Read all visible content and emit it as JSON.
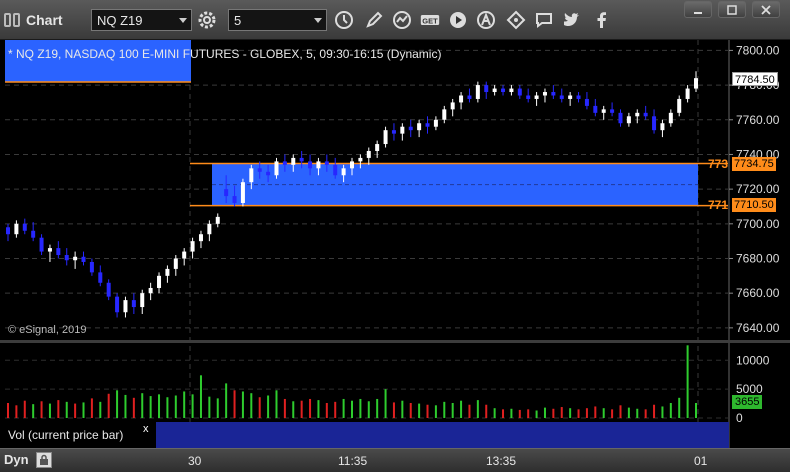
{
  "window": {
    "title": "Chart"
  },
  "toolbar": {
    "symbol_value": "NQ Z19",
    "interval_value": "5",
    "icons": [
      "link-icon",
      "gear-icon",
      "clock-icon",
      "pencil-icon",
      "study-icon",
      "get-icon",
      "play-icon",
      "alert-icon",
      "tools-icon",
      "comment-icon",
      "twitter-icon",
      "facebook-icon"
    ]
  },
  "chart": {
    "symbol_description": "* NQ Z19, NASDAQ 100 E-MINI FUTURES - GLOBEX, 5, 09:30-16:15 (Dynamic)",
    "copyright": "© eSignal, 2019",
    "last_price": "7784.50",
    "zone_high_price": "7734.75",
    "zone_low_price": "7710.50",
    "zone_high_side": "773",
    "zone_low_side": "771",
    "volume_label": "Vol (current price bar)",
    "volume_close": "x",
    "volume_last": "3655",
    "time_labels": [
      "30",
      "11:35",
      "13:35",
      "01"
    ],
    "dyn_label": "Dyn",
    "colors": {
      "up": "#ffffff",
      "down": "#2727ff",
      "zone": "#2b63ff",
      "zone_line": "#ff8c1a",
      "vol_up": "#2ecc2e",
      "vol_down": "#e02020"
    }
  },
  "chart_data": {
    "type": "candlestick",
    "y_ticks": [
      "7800.00",
      "7780.00",
      "7760.00",
      "7740.00",
      "7720.00",
      "7700.00",
      "7680.00",
      "7660.00",
      "7640.00"
    ],
    "ylim": [
      7633,
      7806
    ],
    "volume_ticks": [
      "10000",
      "5000",
      "0"
    ],
    "volume_ylim": [
      0,
      13000
    ],
    "bars": [
      [
        7698,
        7700,
        7690,
        7694
      ],
      [
        7694,
        7702,
        7692,
        7700
      ],
      [
        7700,
        7703,
        7694,
        7696
      ],
      [
        7696,
        7701,
        7690,
        7692
      ],
      [
        7692,
        7694,
        7682,
        7684
      ],
      [
        7684,
        7688,
        7678,
        7686
      ],
      [
        7686,
        7690,
        7680,
        7682
      ],
      [
        7682,
        7686,
        7676,
        7679
      ],
      [
        7679,
        7684,
        7674,
        7681
      ],
      [
        7681,
        7684,
        7676,
        7678
      ],
      [
        7678,
        7680,
        7670,
        7672
      ],
      [
        7672,
        7676,
        7664,
        7666
      ],
      [
        7666,
        7668,
        7656,
        7658
      ],
      [
        7658,
        7660,
        7646,
        7649
      ],
      [
        7649,
        7658,
        7646,
        7656
      ],
      [
        7656,
        7660,
        7648,
        7652
      ],
      [
        7652,
        7662,
        7648,
        7660
      ],
      [
        7660,
        7666,
        7656,
        7663
      ],
      [
        7663,
        7672,
        7660,
        7670
      ],
      [
        7670,
        7676,
        7666,
        7674
      ],
      [
        7674,
        7682,
        7670,
        7680
      ],
      [
        7680,
        7686,
        7676,
        7684
      ],
      [
        7684,
        7692,
        7680,
        7690
      ],
      [
        7690,
        7696,
        7686,
        7694
      ],
      [
        7694,
        7702,
        7690,
        7700
      ],
      [
        7700,
        7706,
        7698,
        7704
      ],
      [
        7720,
        7728,
        7712,
        7716
      ],
      [
        7716,
        7722,
        7710,
        7712
      ],
      [
        7712,
        7726,
        7710,
        7724
      ],
      [
        7724,
        7734,
        7720,
        7732
      ],
      [
        7732,
        7736,
        7726,
        7730
      ],
      [
        7730,
        7734,
        7724,
        7728
      ],
      [
        7728,
        7738,
        7726,
        7736
      ],
      [
        7736,
        7740,
        7730,
        7734
      ],
      [
        7734,
        7740,
        7730,
        7738
      ],
      [
        7738,
        7742,
        7732,
        7736
      ],
      [
        7736,
        7740,
        7728,
        7732
      ],
      [
        7732,
        7738,
        7728,
        7736
      ],
      [
        7736,
        7740,
        7730,
        7734
      ],
      [
        7734,
        7738,
        7726,
        7728
      ],
      [
        7728,
        7734,
        7724,
        7732
      ],
      [
        7732,
        7738,
        7728,
        7736
      ],
      [
        7736,
        7740,
        7732,
        7738
      ],
      [
        7738,
        7744,
        7734,
        7742
      ],
      [
        7742,
        7748,
        7738,
        7746
      ],
      [
        7746,
        7756,
        7744,
        7754
      ],
      [
        7754,
        7758,
        7748,
        7752
      ],
      [
        7752,
        7758,
        7748,
        7756
      ],
      [
        7756,
        7760,
        7750,
        7754
      ],
      [
        7754,
        7760,
        7750,
        7758
      ],
      [
        7758,
        7762,
        7752,
        7756
      ],
      [
        7756,
        7762,
        7754,
        7760
      ],
      [
        7760,
        7768,
        7758,
        7766
      ],
      [
        7766,
        7772,
        7762,
        7770
      ],
      [
        7770,
        7776,
        7766,
        7774
      ],
      [
        7774,
        7778,
        7770,
        7772
      ],
      [
        7772,
        7782,
        7770,
        7780
      ],
      [
        7780,
        7782,
        7772,
        7776
      ],
      [
        7776,
        7780,
        7774,
        7778
      ],
      [
        7778,
        7780,
        7774,
        7776
      ],
      [
        7776,
        7780,
        7774,
        7778
      ],
      [
        7778,
        7780,
        7772,
        7774
      ],
      [
        7774,
        7778,
        7770,
        7772
      ],
      [
        7772,
        7776,
        7768,
        7774
      ],
      [
        7774,
        7778,
        7770,
        7776
      ],
      [
        7776,
        7780,
        7772,
        7774
      ],
      [
        7774,
        7778,
        7770,
        7772
      ],
      [
        7772,
        7776,
        7768,
        7774
      ],
      [
        7774,
        7776,
        7770,
        7772
      ],
      [
        7772,
        7776,
        7766,
        7768
      ],
      [
        7768,
        7772,
        7762,
        7764
      ],
      [
        7764,
        7768,
        7760,
        7766
      ],
      [
        7766,
        7770,
        7762,
        7764
      ],
      [
        7764,
        7766,
        7756,
        7758
      ],
      [
        7758,
        7764,
        7756,
        7762
      ],
      [
        7762,
        7766,
        7758,
        7764
      ],
      [
        7764,
        7768,
        7760,
        7762
      ],
      [
        7762,
        7766,
        7752,
        7754
      ],
      [
        7754,
        7760,
        7750,
        7758
      ],
      [
        7758,
        7766,
        7756,
        7764
      ],
      [
        7764,
        7774,
        7762,
        7772
      ],
      [
        7772,
        7780,
        7770,
        7778
      ],
      [
        7778,
        7788,
        7776,
        7784
      ]
    ],
    "volumes": [
      [
        2600,
        0
      ],
      [
        2200,
        0
      ],
      [
        3000,
        0
      ],
      [
        2400,
        1
      ],
      [
        2900,
        0
      ],
      [
        2500,
        1
      ],
      [
        3100,
        0
      ],
      [
        2800,
        1
      ],
      [
        2500,
        0
      ],
      [
        2700,
        1
      ],
      [
        3400,
        0
      ],
      [
        2800,
        1
      ],
      [
        4200,
        0
      ],
      [
        4800,
        1
      ],
      [
        4000,
        1
      ],
      [
        3500,
        0
      ],
      [
        4300,
        1
      ],
      [
        3800,
        1
      ],
      [
        4100,
        1
      ],
      [
        3600,
        1
      ],
      [
        3900,
        1
      ],
      [
        4600,
        1
      ],
      [
        4100,
        1
      ],
      [
        7400,
        1
      ],
      [
        3700,
        1
      ],
      [
        3400,
        1
      ],
      [
        6000,
        1
      ],
      [
        4800,
        0
      ],
      [
        4600,
        1
      ],
      [
        4300,
        1
      ],
      [
        3600,
        0
      ],
      [
        3900,
        1
      ],
      [
        4800,
        1
      ],
      [
        3300,
        0
      ],
      [
        2900,
        1
      ],
      [
        3000,
        0
      ],
      [
        3300,
        0
      ],
      [
        3100,
        1
      ],
      [
        2600,
        0
      ],
      [
        2800,
        0
      ],
      [
        3300,
        1
      ],
      [
        3000,
        1
      ],
      [
        3300,
        1
      ],
      [
        2900,
        1
      ],
      [
        3300,
        1
      ],
      [
        5000,
        1
      ],
      [
        2700,
        0
      ],
      [
        3000,
        1
      ],
      [
        2600,
        0
      ],
      [
        2500,
        1
      ],
      [
        2300,
        0
      ],
      [
        2200,
        1
      ],
      [
        2800,
        1
      ],
      [
        2600,
        1
      ],
      [
        3000,
        1
      ],
      [
        2300,
        0
      ],
      [
        3100,
        1
      ],
      [
        2300,
        0
      ],
      [
        1700,
        1
      ],
      [
        1500,
        0
      ],
      [
        1600,
        1
      ],
      [
        1400,
        0
      ],
      [
        1500,
        0
      ],
      [
        1300,
        1
      ],
      [
        1800,
        1
      ],
      [
        1600,
        0
      ],
      [
        1900,
        0
      ],
      [
        1700,
        1
      ],
      [
        1500,
        0
      ],
      [
        1700,
        0
      ],
      [
        2000,
        0
      ],
      [
        1700,
        1
      ],
      [
        1500,
        0
      ],
      [
        2200,
        0
      ],
      [
        1800,
        1
      ],
      [
        1600,
        1
      ],
      [
        1500,
        0
      ],
      [
        2300,
        0
      ],
      [
        2000,
        1
      ],
      [
        2600,
        1
      ],
      [
        3500,
        1
      ],
      [
        12600,
        1
      ],
      [
        2600,
        1
      ]
    ]
  }
}
